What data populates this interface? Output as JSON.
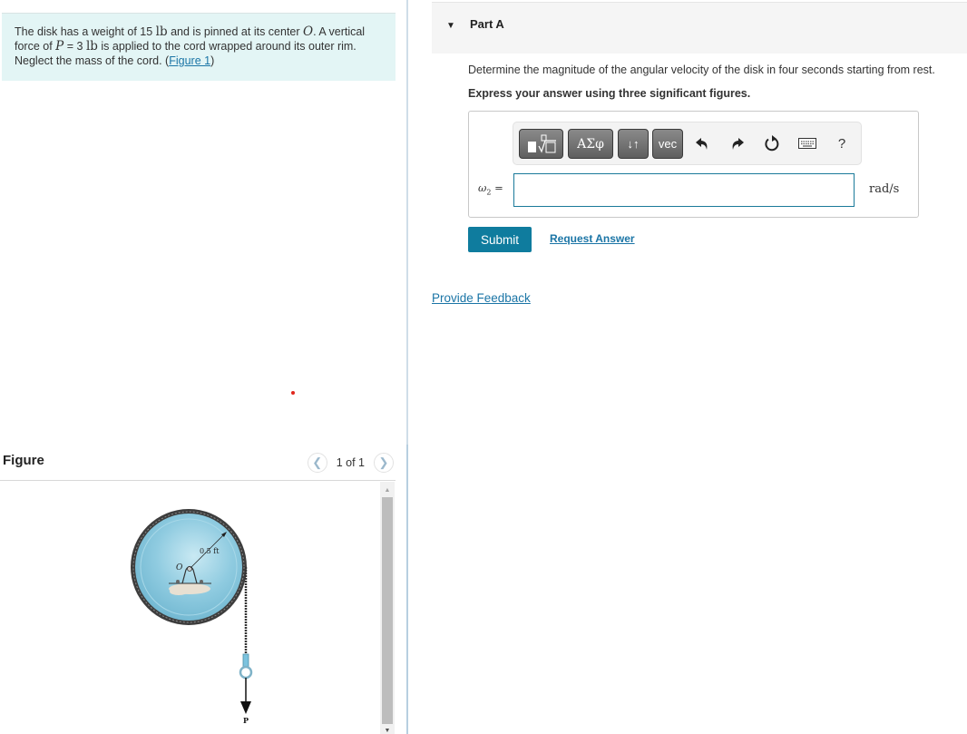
{
  "problem": {
    "text_1": "The disk has a weight of 15 ",
    "unit_lb_1": "lb",
    "text_2": " and is pinned at its center ",
    "symbol_O": "O",
    "text_3": ". A vertical force of ",
    "symbol_P": "P",
    "text_4": " = 3 ",
    "unit_lb_2": "lb",
    "text_5": " is applied to the cord wrapped around its outer rim. Neglect the mass of the cord. (",
    "figure_link": "Figure 1",
    "text_6": ")"
  },
  "figure_panel": {
    "title": "Figure",
    "pager_text": "1 of 1",
    "prev_icon": "chevron-left-icon",
    "next_icon": "chevron-right-icon",
    "diagram": {
      "center_label": "O",
      "radius_label": "0.5 ft",
      "force_label": "P",
      "disk_color": "#8fcbe0",
      "rim_color": "#3d3d3d"
    }
  },
  "part": {
    "title": "Part A",
    "toggle_icon": "caret-down-icon",
    "question": "Determine the magnitude of the angular velocity of the disk in four seconds starting from rest.",
    "instruction": "Express your answer using three significant figures."
  },
  "toolbar": {
    "templates_label": "templates",
    "greek_label": "ΑΣφ",
    "arrows_label": "↓↑",
    "vec_label": "vec",
    "undo_icon": "undo-icon",
    "redo_icon": "redo-icon",
    "reset_icon": "reset-icon",
    "keyboard_icon": "keyboard-icon",
    "help_label": "?"
  },
  "answer": {
    "variable": "ω",
    "subscript": "2",
    "equals": " =",
    "value": "",
    "unit": "rad/s"
  },
  "actions": {
    "submit_label": "Submit",
    "request_answer_label": "Request Answer",
    "feedback_label": "Provide Feedback"
  },
  "colors": {
    "accent": "#0f7c9e",
    "link": "#1b75a6",
    "problem_bg": "#e3f5f5"
  }
}
